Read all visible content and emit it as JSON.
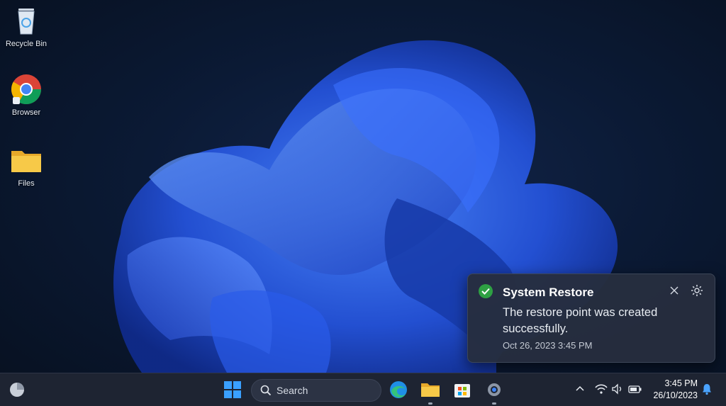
{
  "desktop": {
    "icons": [
      {
        "label": "Recycle Bin",
        "icon": "recycle-bin-icon"
      },
      {
        "label": "Browser",
        "icon": "chrome-icon"
      },
      {
        "label": "Files",
        "icon": "folder-icon"
      }
    ]
  },
  "notification": {
    "app": "System Restore",
    "message": "The restore point was created successfully.",
    "time": "Oct 26, 2023 3:45 PM",
    "status_color": "#2ea043"
  },
  "taskbar": {
    "search_label": "Search",
    "pinned": [
      {
        "name": "start-button",
        "icon": "windows-icon"
      },
      {
        "name": "edge-button",
        "icon": "edge-icon"
      },
      {
        "name": "file-explorer-button",
        "icon": "folder-icon"
      },
      {
        "name": "store-button",
        "icon": "store-icon"
      },
      {
        "name": "settings-button",
        "icon": "gear-icon"
      }
    ],
    "clock_time": "3:45 PM",
    "clock_date": "26/10/2023"
  },
  "colors": {
    "accent": "#1f6fe0",
    "taskbar_bg": "#1e2432"
  }
}
